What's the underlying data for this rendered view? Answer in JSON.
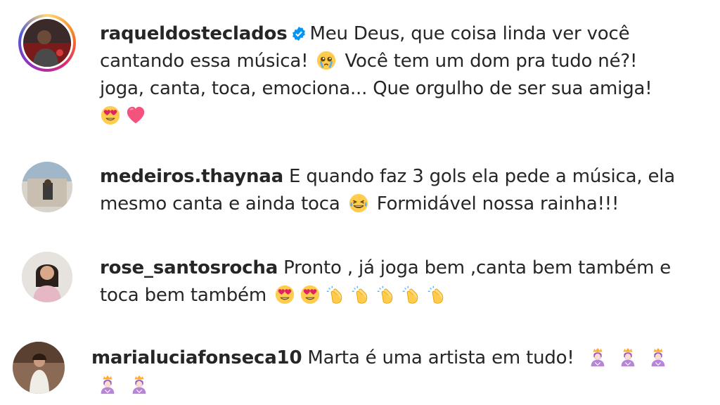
{
  "comments": [
    {
      "username": "raqueldosteclados",
      "verified": true,
      "story_ring": true,
      "line1": "Meu Deus, que coisa linda ver você",
      "line2a": "cantando essa música!",
      "line2b": "Você tem um dom pra tudo né?!",
      "line3": "joga, canta, toca, emociona... Que orgulho de ser sua amiga!",
      "emojis_line2": [
        "crying-face"
      ],
      "emojis_line4": [
        "heart-eyes-face",
        "pink-heart"
      ]
    },
    {
      "username": "medeiros.thaynaa",
      "line1": "E quando faz 3 gols ela pede a música, ela",
      "line2a": "mesmo canta e ainda toca",
      "line2b": "Formidável nossa rainha!!!",
      "emojis_line2": [
        "laughing-face"
      ]
    },
    {
      "username": "rose_santosrocha",
      "line1": "Pronto , já joga bem ,canta bem também e",
      "line2a": "toca bem também",
      "emojis_line2": [
        "heart-eyes-face",
        "heart-eyes-face",
        "clapping-hands",
        "clapping-hands",
        "clapping-hands",
        "clapping-hands",
        "clapping-hands"
      ]
    },
    {
      "username": "marialuciafonseca10",
      "line1": "Marta é uma artista em tudo!",
      "emojis_line1": [
        "princess",
        "princess",
        "princess"
      ],
      "emojis_line2": [
        "princess",
        "princess"
      ]
    }
  ],
  "colors": {
    "text": "#262626",
    "verified_badge": "#0095f6",
    "background": "#ffffff"
  }
}
